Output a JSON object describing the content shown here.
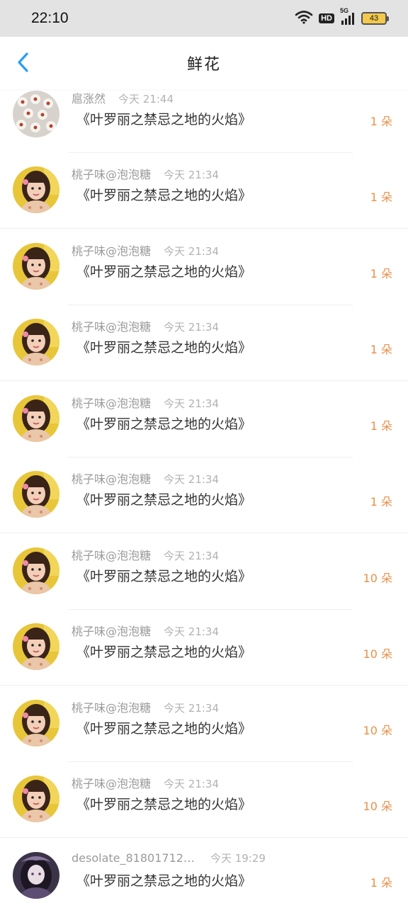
{
  "status_bar": {
    "time": "22:10",
    "network": "5G",
    "hd": "HD",
    "battery": "43"
  },
  "header": {
    "title": "鲜花",
    "back_icon": "chevron-left-icon"
  },
  "colors": {
    "accent": "#2a9df4",
    "count": "#e8904a"
  },
  "records": [
    {
      "user": "扈涨然",
      "time": "今天 21:44",
      "book": "《叶罗丽之禁忌之地的火焰》",
      "count": "1 朵",
      "avatar": "flowers"
    },
    {
      "user": "桃子味@泡泡糖",
      "time": "今天 21:34",
      "book": "《叶罗丽之禁忌之地的火焰》",
      "count": "1 朵",
      "avatar": "girl"
    },
    {
      "user": "桃子味@泡泡糖",
      "time": "今天 21:34",
      "book": "《叶罗丽之禁忌之地的火焰》",
      "count": "1 朵",
      "avatar": "girl"
    },
    {
      "user": "桃子味@泡泡糖",
      "time": "今天 21:34",
      "book": "《叶罗丽之禁忌之地的火焰》",
      "count": "1 朵",
      "avatar": "girl"
    },
    {
      "user": "桃子味@泡泡糖",
      "time": "今天 21:34",
      "book": "《叶罗丽之禁忌之地的火焰》",
      "count": "1 朵",
      "avatar": "girl"
    },
    {
      "user": "桃子味@泡泡糖",
      "time": "今天 21:34",
      "book": "《叶罗丽之禁忌之地的火焰》",
      "count": "1 朵",
      "avatar": "girl"
    },
    {
      "user": "桃子味@泡泡糖",
      "time": "今天 21:34",
      "book": "《叶罗丽之禁忌之地的火焰》",
      "count": "10 朵",
      "avatar": "girl"
    },
    {
      "user": "桃子味@泡泡糖",
      "time": "今天 21:34",
      "book": "《叶罗丽之禁忌之地的火焰》",
      "count": "10 朵",
      "avatar": "girl"
    },
    {
      "user": "桃子味@泡泡糖",
      "time": "今天 21:34",
      "book": "《叶罗丽之禁忌之地的火焰》",
      "count": "10 朵",
      "avatar": "girl"
    },
    {
      "user": "桃子味@泡泡糖",
      "time": "今天 21:34",
      "book": "《叶罗丽之禁忌之地的火焰》",
      "count": "10 朵",
      "avatar": "girl"
    },
    {
      "user": "desolate_81801712…",
      "time": "今天 19:29",
      "book": "《叶罗丽之禁忌之地的火焰》",
      "count": "1 朵",
      "avatar": "dark"
    }
  ]
}
